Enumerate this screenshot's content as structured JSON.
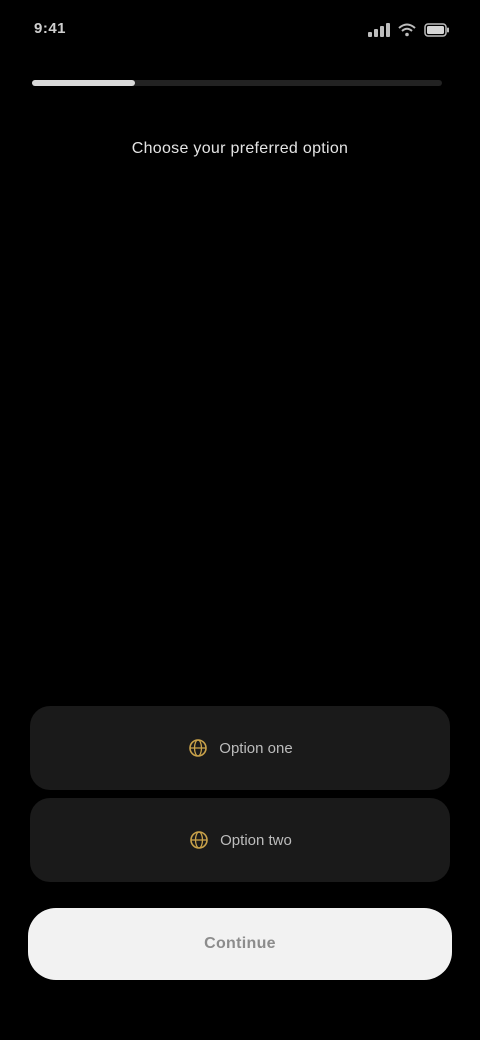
{
  "status_bar": {
    "time": "9:41",
    "icons": [
      "signal-icon",
      "wifi-icon",
      "battery-icon"
    ]
  },
  "progress": {
    "fraction": 0.25
  },
  "title": "Choose your preferred option",
  "options": [
    {
      "icon": "globe-icon",
      "label": "Option one",
      "icon_color": "#c9a24a"
    },
    {
      "icon": "globe-icon",
      "label": "Option two",
      "icon_color": "#c9a24a"
    }
  ],
  "primary_button": {
    "label": "Continue"
  },
  "colors": {
    "background": "#000000",
    "card": "#1a1a1a",
    "button": "#f2f2f2",
    "accent": "#c9a24a"
  }
}
